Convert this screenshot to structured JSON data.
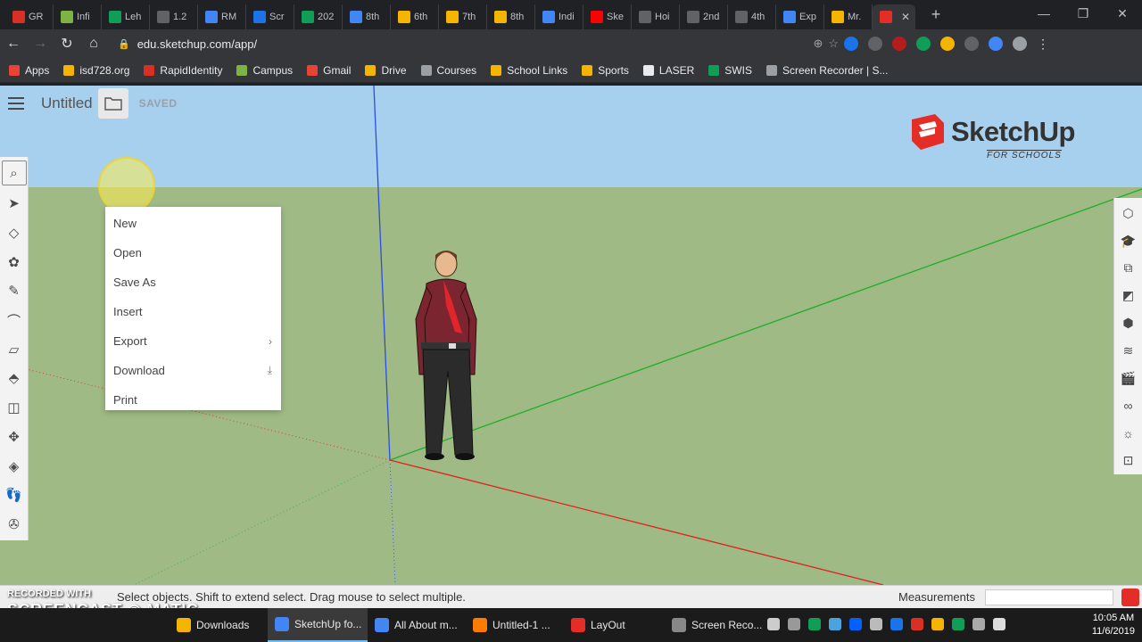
{
  "browser": {
    "tabs": [
      {
        "label": "GR",
        "color": "#d93025"
      },
      {
        "label": "Infi",
        "color": "#7cb342"
      },
      {
        "label": "Leh",
        "color": "#0f9d58"
      },
      {
        "label": "1.2",
        "color": "#5f6368"
      },
      {
        "label": "RM",
        "color": "#4285f4"
      },
      {
        "label": "Scr",
        "color": "#1a73e8"
      },
      {
        "label": "202",
        "color": "#0f9d58"
      },
      {
        "label": "8th",
        "color": "#4285f4"
      },
      {
        "label": "6th",
        "color": "#f4b400"
      },
      {
        "label": "7th",
        "color": "#f4b400"
      },
      {
        "label": "8th",
        "color": "#f4b400"
      },
      {
        "label": "Indi",
        "color": "#4285f4"
      },
      {
        "label": "Ske",
        "color": "#ff0000"
      },
      {
        "label": "Hoi",
        "color": "#5f6368"
      },
      {
        "label": "2nd",
        "color": "#5f6368"
      },
      {
        "label": "4th",
        "color": "#5f6368"
      },
      {
        "label": "Exp",
        "color": "#4285f4"
      },
      {
        "label": "Mr.",
        "color": "#f4b400"
      }
    ],
    "active_tab_color": "#e52d27",
    "new_tab": "+",
    "window_controls": [
      "—",
      "❐",
      "✕"
    ],
    "url": "edu.sketchup.com/app/",
    "nav": {
      "back": "←",
      "forward": "→",
      "reload": "↻",
      "home": "⌂"
    },
    "bookmarks": [
      {
        "label": "Apps",
        "color": "#ea4335"
      },
      {
        "label": "isd728.org",
        "color": "#f4b400"
      },
      {
        "label": "RapidIdentity",
        "color": "#d93025"
      },
      {
        "label": "Campus",
        "color": "#7cb342"
      },
      {
        "label": "Gmail",
        "color": "#ea4335"
      },
      {
        "label": "Drive",
        "color": "#f4b400"
      },
      {
        "label": "Courses",
        "color": "#9aa0a6"
      },
      {
        "label": "School Links",
        "color": "#f4b400"
      },
      {
        "label": "Sports",
        "color": "#f4b400"
      },
      {
        "label": "LASER",
        "color": "#e8eaed"
      },
      {
        "label": "SWIS",
        "color": "#0f9d58"
      },
      {
        "label": "Screen Recorder | S...",
        "color": "#9aa0a6"
      }
    ]
  },
  "app": {
    "title": "Untitled",
    "saved": "SAVED",
    "logo_name": "SketchUp",
    "logo_sub": "FOR SCHOOLS",
    "file_menu": [
      "New",
      "Open",
      "Save As",
      "Insert",
      "Export",
      "Download",
      "Print"
    ],
    "export_arrow": "›",
    "status_text": "Select objects. Shift to extend select. Drag mouse to select multiple.",
    "measurements_label": "Measurements"
  },
  "watermark": {
    "line1": "RECORDED WITH",
    "line2": "SCREENCAST ◉ MATIC"
  },
  "taskbar": {
    "items": [
      {
        "label": "Downloads",
        "color": "#f4b400"
      },
      {
        "label": "SketchUp fo...",
        "color": "#4285f4"
      },
      {
        "label": "All About m...",
        "color": "#4285f4"
      },
      {
        "label": "Untitled-1 ...",
        "color": "#ff7c00"
      },
      {
        "label": "LayOut",
        "color": "#e52d27"
      },
      {
        "label": "Screen Reco...",
        "color": "#888888"
      }
    ],
    "time": "10:05 AM",
    "date": "11/6/2019"
  }
}
